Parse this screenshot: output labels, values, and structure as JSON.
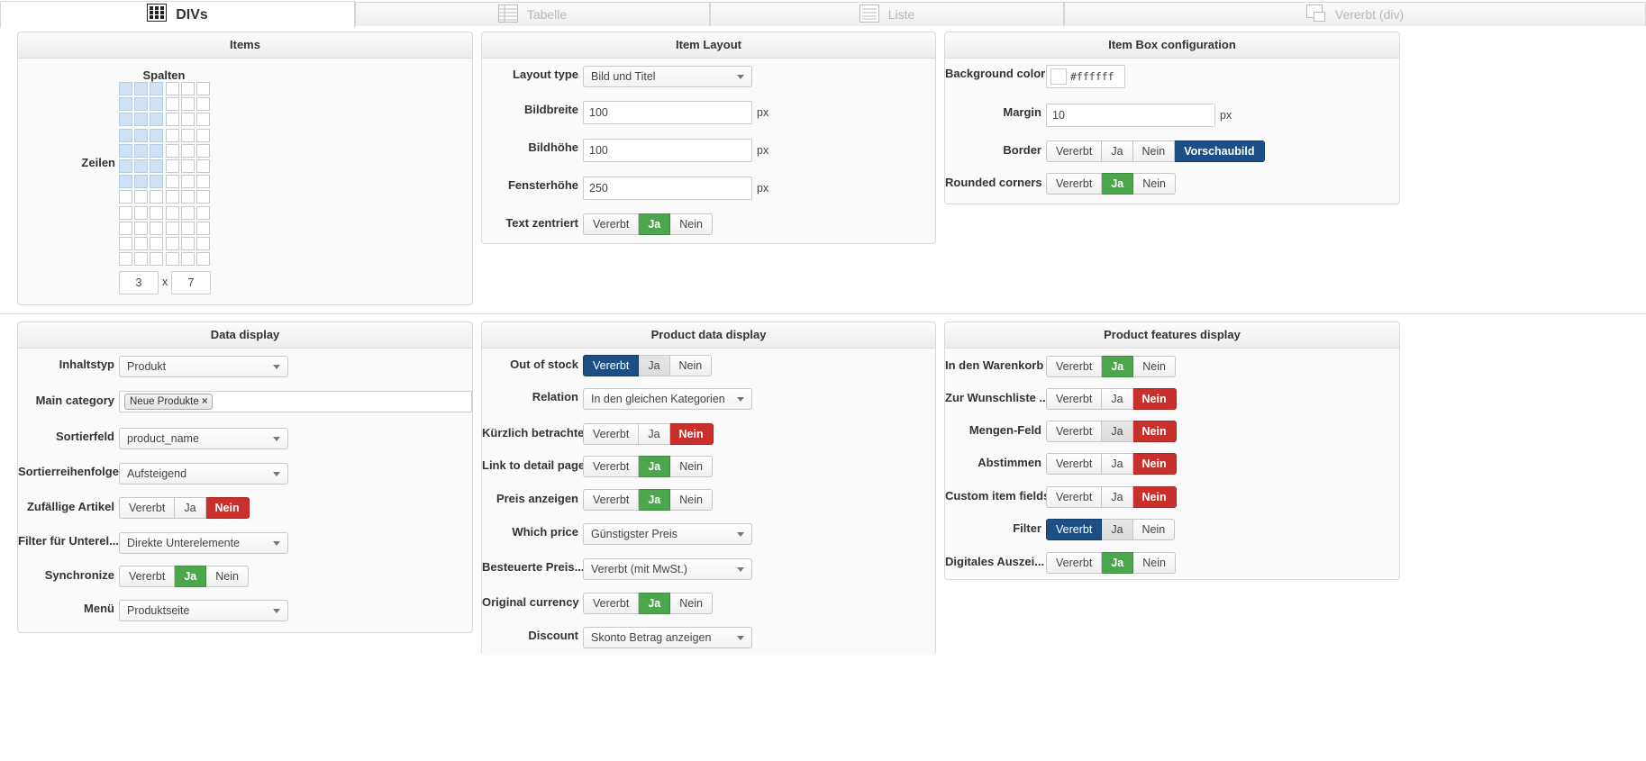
{
  "tabs": [
    {
      "label": "DIVs",
      "icon": "grid-icon"
    },
    {
      "label": "Tabelle",
      "icon": "table-icon"
    },
    {
      "label": "Liste",
      "icon": "list-icon"
    },
    {
      "label": "Vererbt (div)",
      "icon": "inherit-icon"
    }
  ],
  "items_panel": {
    "title": "Items",
    "columns_label": "Spalten",
    "rows_label": "Zeilen",
    "grid_selected_cols": 3,
    "grid_selected_rows": 7,
    "grid_total_cols": 6,
    "grid_total_rows": 12,
    "cols_value": "3",
    "times": "x",
    "rows_value": "7"
  },
  "item_layout": {
    "title": "Item Layout",
    "layout_type_label": "Layout type",
    "layout_type_value": "Bild und Titel",
    "bildbreite_label": "Bildbreite",
    "bildbreite_value": "100",
    "bildhoehe_label": "Bildhöhe",
    "bildhoehe_value": "100",
    "fensterhoehe_label": "Fensterhöhe",
    "fensterhoehe_value": "250",
    "unit": "px",
    "text_zentriert_label": "Text zentriert"
  },
  "item_box": {
    "title": "Item Box configuration",
    "bg_color_label": "Background color",
    "bg_color_value": "#ffffff",
    "margin_label": "Margin",
    "margin_value": "10",
    "unit": "px",
    "border_label": "Border",
    "rounded_label": "Rounded corners"
  },
  "buttons": {
    "vererbt": "Vererbt",
    "ja": "Ja",
    "nein": "Nein",
    "vorschaubild": "Vorschaubild"
  },
  "data_display": {
    "title": "Data display",
    "inhaltstyp_label": "Inhaltstyp",
    "inhaltstyp_value": "Produkt",
    "main_category_label": "Main category",
    "main_category_tag": "Neue Produkte",
    "tag_remove": "×",
    "sortierfeld_label": "Sortierfeld",
    "sortierfeld_value": "product_name",
    "sortierreihenfolge_label": "Sortierreihenfolge",
    "sortierreihenfolge_value": "Aufsteigend",
    "zufaellige_label": "Zufällige Artikel",
    "filter_label": "Filter für Unterel...",
    "filter_value": "Direkte Unterelemente",
    "synchronize_label": "Synchronize",
    "menu_label": "Menü",
    "menu_value": "Produktseite"
  },
  "product_data": {
    "title": "Product data display",
    "out_of_stock_label": "Out of stock",
    "relation_label": "Relation",
    "relation_value": "In den gleichen Kategorien",
    "kuerzlich_label": "Kürzlich betrachtet",
    "link_detail_label": "Link to detail page",
    "preis_anzeigen_label": "Preis anzeigen",
    "which_price_label": "Which price",
    "which_price_value": "Günstigster Preis",
    "besteuerte_label": "Besteuerte Preis...",
    "besteuerte_value": "Vererbt (mit MwSt.)",
    "original_currency_label": "Original currency",
    "discount_label": "Discount",
    "discount_value": "Skonto Betrag anzeigen"
  },
  "product_features": {
    "title": "Product features display",
    "warenkorb_label": "In den Warenkorb",
    "wunschliste_label": "Zur Wunschliste ...",
    "mengen_label": "Mengen-Feld",
    "abstimmen_label": "Abstimmen",
    "custom_fields_label": "Custom item fields",
    "filter_label": "Filter",
    "digitales_label": "Digitales Auszei..."
  },
  "colors": {
    "green": "#4ca64c",
    "red": "#c9302c",
    "blue": "#1c4f86",
    "grid_selected": "#cfe2f5"
  }
}
